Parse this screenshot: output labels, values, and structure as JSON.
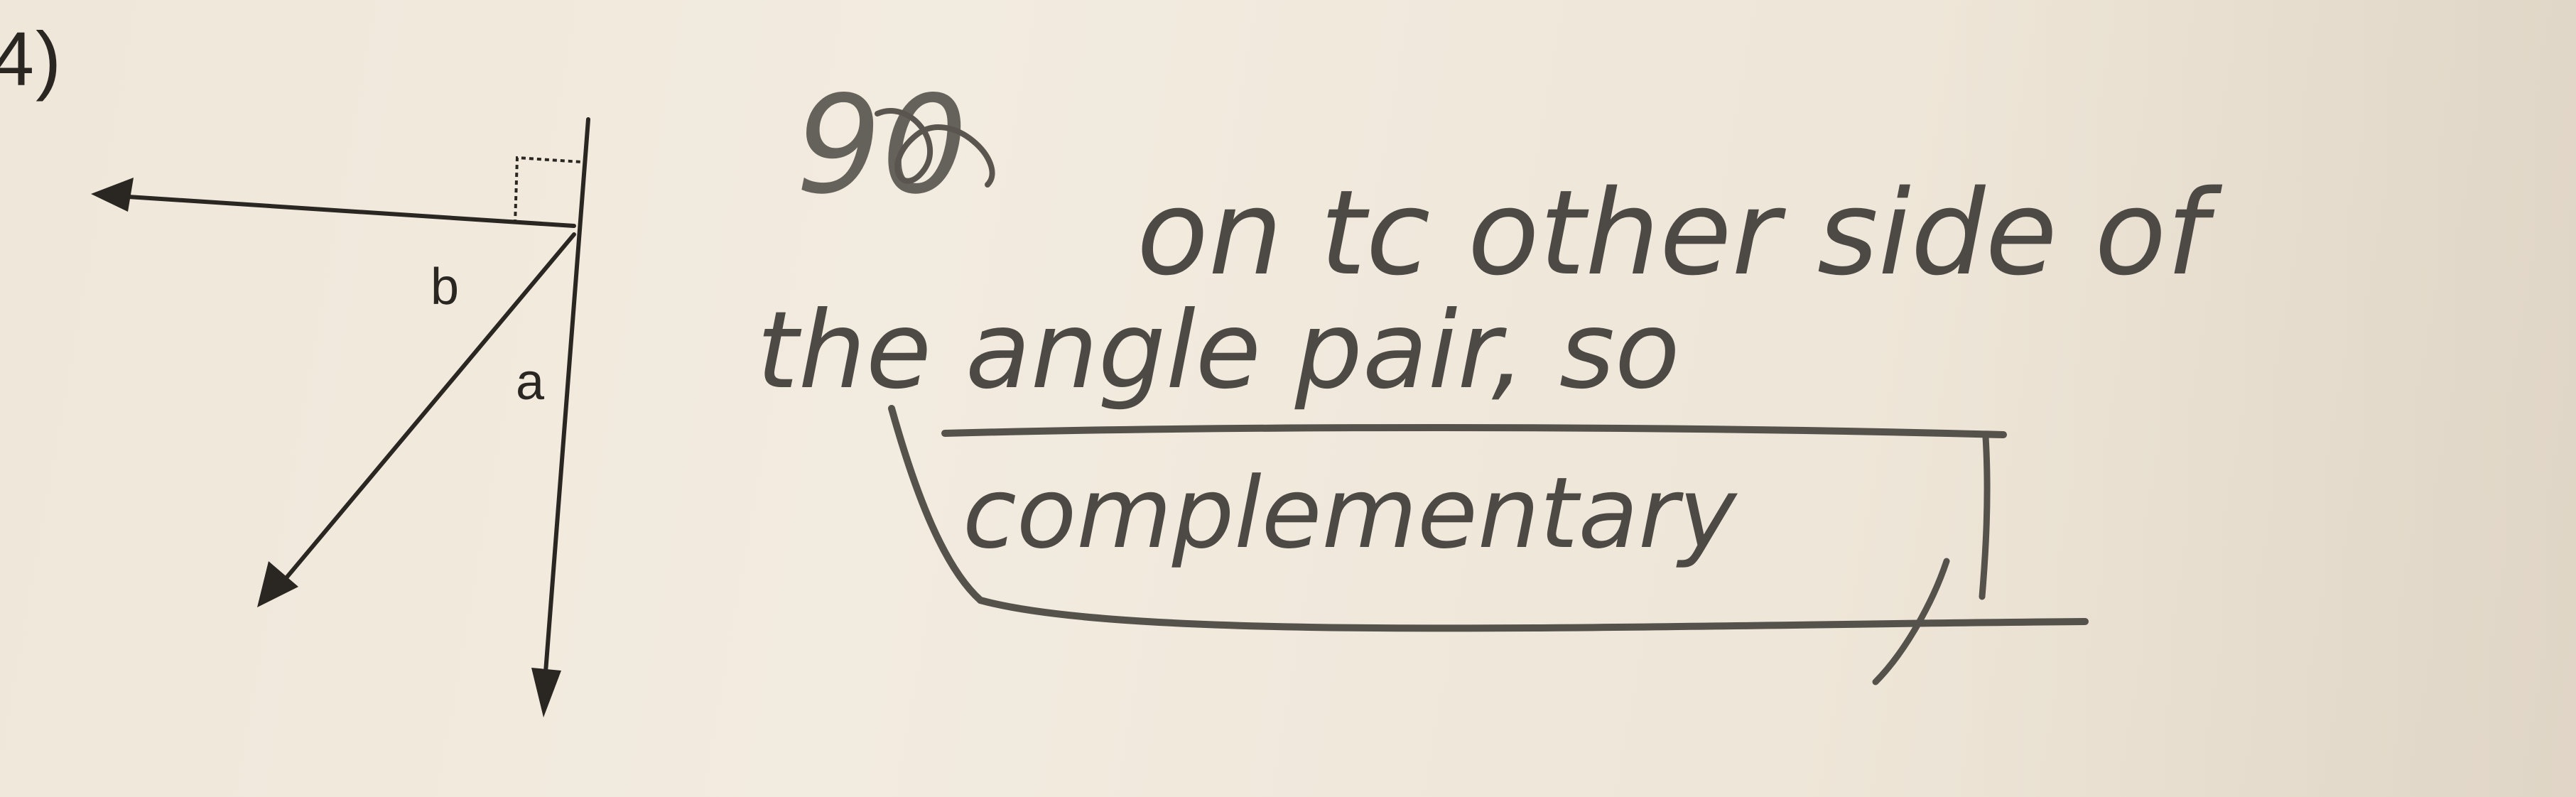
{
  "problem_number": "4)",
  "diagram": {
    "angle_labels": {
      "b": "b",
      "a": "a"
    },
    "right_angle_marker": "dashed-square"
  },
  "handwriting": {
    "line1": {
      "scribbled_prefix": "90",
      "text": "on tc other side of"
    },
    "line2": {
      "text": "the angle pair, so"
    },
    "answer": {
      "text": "complementary"
    }
  },
  "colors": {
    "paper": "#efe7d9",
    "print_ink": "#2a2622",
    "pencil": "#4d4a45"
  }
}
